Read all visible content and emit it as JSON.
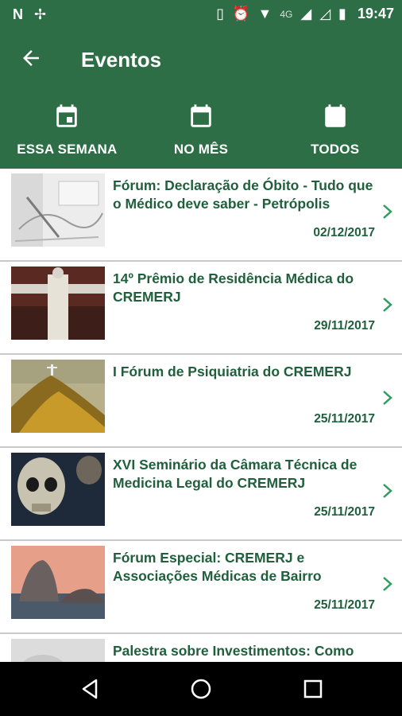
{
  "status_bar": {
    "network": "4G",
    "time": "19:47"
  },
  "header": {
    "title": "Eventos"
  },
  "tabs": [
    {
      "label": "ESSA SEMANA",
      "icon": "calendar-today-icon"
    },
    {
      "label": "NO MÊS",
      "icon": "calendar-month-icon"
    },
    {
      "label": "TODOS",
      "icon": "calendar-all-icon"
    }
  ],
  "events": [
    {
      "title": "Fórum: Declaração de Óbito - Tudo que o Médico deve saber - Petrópolis",
      "date": "02/12/2017",
      "thumb": "sketch"
    },
    {
      "title": "14º Prêmio de Residência Médica do CREMERJ",
      "date": "29/11/2017",
      "thumb": "christ"
    },
    {
      "title": "I Fórum de Psiquiatria do CREMERJ",
      "date": "25/11/2017",
      "thumb": "corcovado"
    },
    {
      "title": "XVI Seminário da Câmara Técnica de Medicina Legal do CREMERJ",
      "date": "25/11/2017",
      "thumb": "skull"
    },
    {
      "title": "Fórum Especial: CREMERJ e Associações Médicas de Bairro",
      "date": "25/11/2017",
      "thumb": "sugarloaf"
    },
    {
      "title": "Palestra sobre Investimentos: Como Investir seu Dinheiro em Tempos de",
      "date": "",
      "thumb": "grey"
    }
  ],
  "colors": {
    "primary": "#2e6e46",
    "text_accent": "#1f5f3c",
    "chevron": "#2e9e5e"
  }
}
